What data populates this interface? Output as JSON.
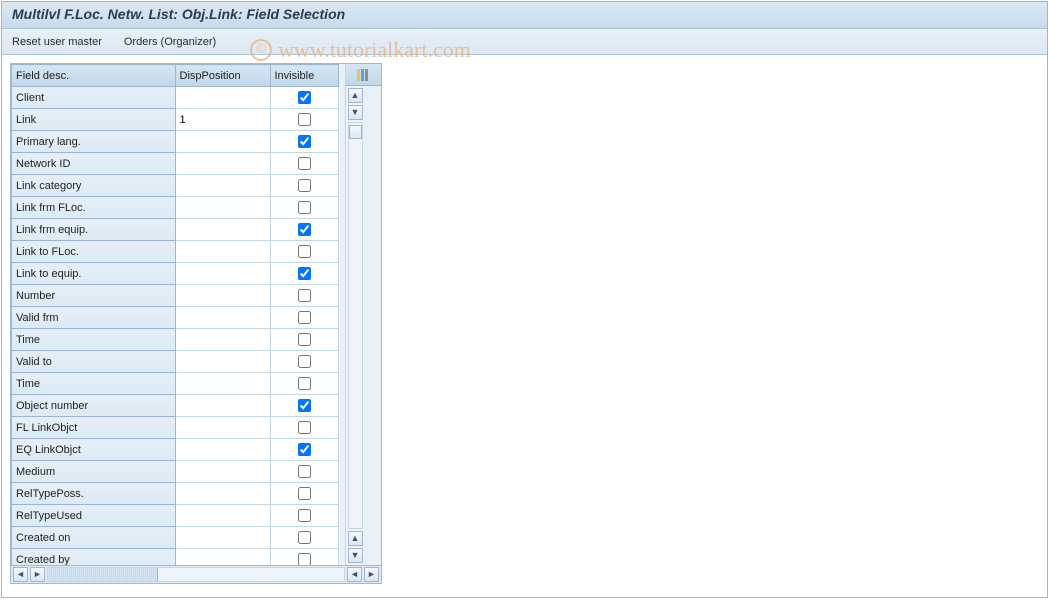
{
  "window": {
    "title": "Multilvl F.Loc. Netw. List: Obj.Link: Field Selection"
  },
  "toolbar": {
    "reset_user_master": "Reset user master",
    "orders_organizer": "Orders (Organizer)"
  },
  "watermark": {
    "symbol": "©",
    "text": "www.tutorialkart.com"
  },
  "table": {
    "headers": {
      "field_desc": "Field desc.",
      "dispposition": "DispPosition",
      "invisible": "Invisible"
    },
    "rows": [
      {
        "label": "Client",
        "disp": "",
        "invisible": true
      },
      {
        "label": "Link",
        "disp": "1",
        "invisible": false
      },
      {
        "label": "Primary lang.",
        "disp": "",
        "invisible": true
      },
      {
        "label": "Network ID",
        "disp": "",
        "invisible": false
      },
      {
        "label": "Link category",
        "disp": "",
        "invisible": false
      },
      {
        "label": "Link frm FLoc.",
        "disp": "",
        "invisible": false
      },
      {
        "label": "Link frm equip.",
        "disp": "",
        "invisible": true
      },
      {
        "label": "Link to FLoc.",
        "disp": "",
        "invisible": false
      },
      {
        "label": "Link to equip.",
        "disp": "",
        "invisible": true
      },
      {
        "label": "Number",
        "disp": "",
        "invisible": false
      },
      {
        "label": "Valid frm",
        "disp": "",
        "invisible": false
      },
      {
        "label": "Time",
        "disp": "",
        "invisible": false
      },
      {
        "label": "Valid to",
        "disp": "",
        "invisible": false
      },
      {
        "label": "Time",
        "disp": "",
        "invisible": false
      },
      {
        "label": "Object number",
        "disp": "",
        "invisible": true
      },
      {
        "label": "FL LinkObjct",
        "disp": "",
        "invisible": false
      },
      {
        "label": "EQ LinkObjct",
        "disp": "",
        "invisible": true
      },
      {
        "label": "Medium",
        "disp": "",
        "invisible": false
      },
      {
        "label": "RelTypePoss.",
        "disp": "",
        "invisible": false
      },
      {
        "label": "RelTypeUsed",
        "disp": "",
        "invisible": false
      },
      {
        "label": "Created on",
        "disp": "",
        "invisible": false
      },
      {
        "label": "Created by",
        "disp": "",
        "invisible": false
      }
    ]
  }
}
